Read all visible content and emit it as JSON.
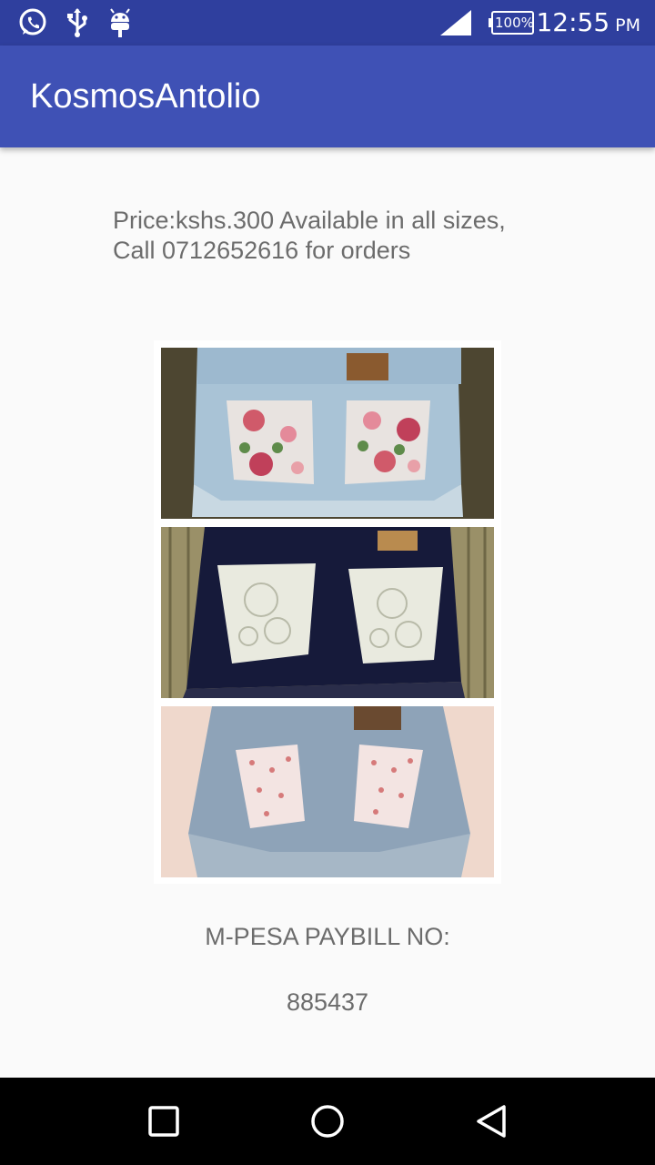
{
  "status_bar": {
    "icons_left": [
      "whatsapp-icon",
      "usb-icon",
      "android-debug-icon"
    ],
    "signal": "signal-full-icon",
    "battery_level": "100%",
    "time": "12:55",
    "ampm": "PM"
  },
  "app_bar": {
    "title": "KosmosAntolio",
    "color": "#3f51b5"
  },
  "content": {
    "description": "Price:kshs.300 Available in all sizes,\nCall 0712652616 for orders",
    "image_panels": [
      "floral-pocket-shorts",
      "lace-pocket-shorts",
      "rose-print-pocket-shorts"
    ],
    "paybill_label": "M-PESA PAYBILL NO:",
    "paybill_number": "885437"
  },
  "nav_bar": {
    "buttons": [
      "recent-apps-icon",
      "home-icon",
      "back-icon"
    ]
  }
}
